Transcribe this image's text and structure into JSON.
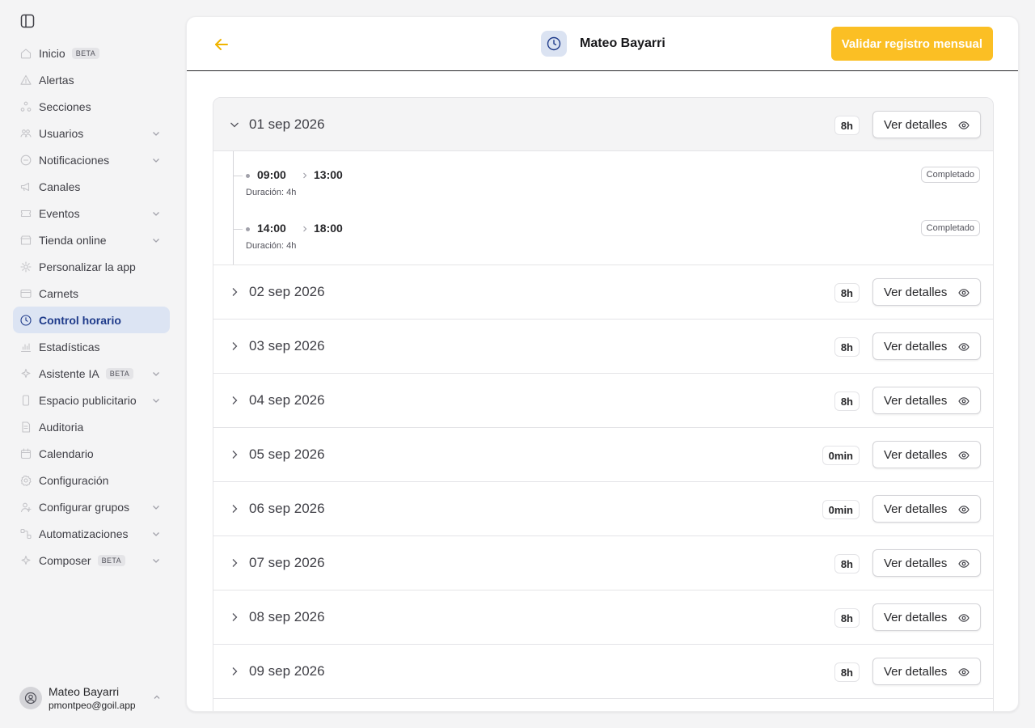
{
  "sidebar": {
    "toggle_icon": "sidebar-panel-icon",
    "items": [
      {
        "label": "Inicio",
        "badge": "BETA",
        "icon": "home-icon"
      },
      {
        "label": "Alertas",
        "icon": "alert-triangle-icon"
      },
      {
        "label": "Secciones",
        "icon": "sections-icon"
      },
      {
        "label": "Usuarios",
        "icon": "users-icon",
        "expandable": true
      },
      {
        "label": "Notificaciones",
        "icon": "message-icon",
        "expandable": true
      },
      {
        "label": "Canales",
        "icon": "megaphone-icon"
      },
      {
        "label": "Eventos",
        "icon": "ticket-icon",
        "expandable": true
      },
      {
        "label": "Tienda online",
        "icon": "shop-icon",
        "expandable": true
      },
      {
        "label": "Personalizar la app",
        "icon": "customize-icon"
      },
      {
        "label": "Carnets",
        "icon": "card-icon"
      },
      {
        "label": "Control horario",
        "icon": "clock-icon",
        "active": true
      },
      {
        "label": "Estadísticas",
        "icon": "chart-icon"
      },
      {
        "label": "Asistente IA",
        "badge": "BETA",
        "icon": "sparkle-icon",
        "expandable": true
      },
      {
        "label": "Espacio publicitario",
        "icon": "phone-icon",
        "expandable": true
      },
      {
        "label": "Auditoria",
        "icon": "document-icon"
      },
      {
        "label": "Calendario",
        "icon": "calendar-icon"
      },
      {
        "label": "Configuración",
        "icon": "settings-icon"
      },
      {
        "label": "Configurar grupos",
        "icon": "user-group-icon",
        "expandable": true
      },
      {
        "label": "Automatizaciones",
        "icon": "workflow-icon",
        "expandable": true
      },
      {
        "label": "Composer",
        "badge": "BETA",
        "icon": "sparkle-icon",
        "expandable": true
      }
    ],
    "user": {
      "name": "Mateo Bayarri",
      "email": "pmontpeo@goil.app"
    }
  },
  "header": {
    "title": "Mateo Bayarri",
    "validate_label": "Validar registro mensual"
  },
  "days": [
    {
      "date": "01 sep 2026",
      "hours": "8h",
      "details_label": "Ver detalles",
      "open": true,
      "shifts": [
        {
          "start": "09:00",
          "end": "13:00",
          "duration": "Duración: 4h",
          "status": "Completado"
        },
        {
          "start": "14:00",
          "end": "18:00",
          "duration": "Duración: 4h",
          "status": "Completado"
        }
      ]
    },
    {
      "date": "02 sep 2026",
      "hours": "8h",
      "details_label": "Ver detalles"
    },
    {
      "date": "03 sep 2026",
      "hours": "8h",
      "details_label": "Ver detalles"
    },
    {
      "date": "04 sep 2026",
      "hours": "8h",
      "details_label": "Ver detalles"
    },
    {
      "date": "05 sep 2026",
      "hours": "0min",
      "details_label": "Ver detalles"
    },
    {
      "date": "06 sep 2026",
      "hours": "0min",
      "details_label": "Ver detalles"
    },
    {
      "date": "07 sep 2026",
      "hours": "8h",
      "details_label": "Ver detalles"
    },
    {
      "date": "08 sep 2026",
      "hours": "8h",
      "details_label": "Ver detalles"
    },
    {
      "date": "09 sep 2026",
      "hours": "8h",
      "details_label": "Ver detalles"
    },
    {
      "date": "",
      "hours": "",
      "details_label": ""
    }
  ],
  "colors": {
    "accent": "#fbbf24",
    "active_nav_bg": "#dce4f3",
    "active_nav_text": "#1e3a8a"
  }
}
